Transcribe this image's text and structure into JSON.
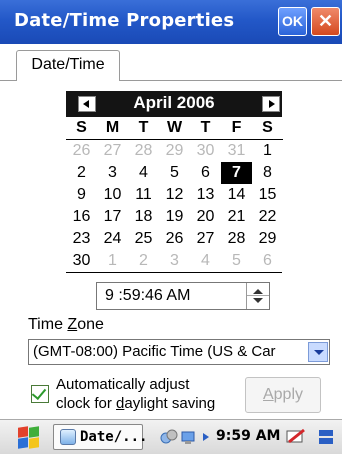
{
  "window": {
    "title": "Date/Time Properties",
    "ok_label": "OK",
    "close_label": "✕"
  },
  "tabs": [
    {
      "label": "Date/Time"
    }
  ],
  "calendar": {
    "month_label": "April 2006",
    "weekdays": [
      "S",
      "M",
      "T",
      "W",
      "T",
      "F",
      "S"
    ],
    "weeks": [
      [
        {
          "d": "26",
          "o": true
        },
        {
          "d": "27",
          "o": true
        },
        {
          "d": "28",
          "o": true
        },
        {
          "d": "29",
          "o": true
        },
        {
          "d": "30",
          "o": true
        },
        {
          "d": "31",
          "o": true
        },
        {
          "d": "1"
        }
      ],
      [
        {
          "d": "2"
        },
        {
          "d": "3"
        },
        {
          "d": "4"
        },
        {
          "d": "5"
        },
        {
          "d": "6"
        },
        {
          "d": "7",
          "sel": true
        },
        {
          "d": "8"
        }
      ],
      [
        {
          "d": "9"
        },
        {
          "d": "10"
        },
        {
          "d": "11"
        },
        {
          "d": "12"
        },
        {
          "d": "13"
        },
        {
          "d": "14"
        },
        {
          "d": "15"
        }
      ],
      [
        {
          "d": "16"
        },
        {
          "d": "17"
        },
        {
          "d": "18"
        },
        {
          "d": "19"
        },
        {
          "d": "20"
        },
        {
          "d": "21"
        },
        {
          "d": "22"
        }
      ],
      [
        {
          "d": "23"
        },
        {
          "d": "24"
        },
        {
          "d": "25"
        },
        {
          "d": "26"
        },
        {
          "d": "27"
        },
        {
          "d": "28"
        },
        {
          "d": "29"
        }
      ],
      [
        {
          "d": "30"
        },
        {
          "d": "1",
          "o": true
        },
        {
          "d": "2",
          "o": true
        },
        {
          "d": "3",
          "o": true
        },
        {
          "d": "4",
          "o": true
        },
        {
          "d": "5",
          "o": true
        },
        {
          "d": "6",
          "o": true
        }
      ]
    ],
    "selected_day": "7"
  },
  "time": {
    "value": "9 :59:46 AM"
  },
  "timezone": {
    "label_pre": "Time ",
    "label_accel": "Z",
    "label_post": "one",
    "value": "(GMT-08:00) Pacific Time (US & Car"
  },
  "daylight": {
    "checked": true,
    "line1": "Automatically adjust",
    "line2_pre": "clock for ",
    "line2_accel": "d",
    "line2_post": "aylight saving"
  },
  "apply": {
    "accel": "A",
    "rest": "pply",
    "enabled": false
  },
  "taskbar": {
    "task_label": "Date/...",
    "clock": "9:59 AM"
  },
  "colors": {
    "titlebar": "#2358c8",
    "selected_day_bg": "#000000",
    "apply_disabled_text": "#a9a9a9"
  }
}
